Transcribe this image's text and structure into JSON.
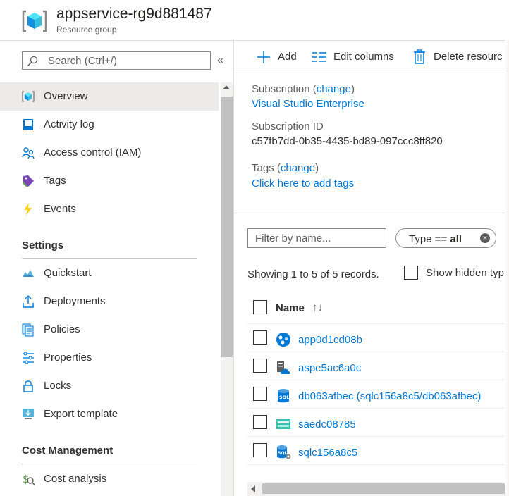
{
  "header": {
    "title": "appservice-rg9d881487",
    "subtitle": "Resource group",
    "icon": "resource-group-cube-icon"
  },
  "nav": {
    "search_placeholder": "Search (Ctrl+/)",
    "collapse_glyph": "«",
    "items": [
      {
        "label": "Overview",
        "icon": "overview-icon",
        "active": true
      },
      {
        "label": "Activity log",
        "icon": "activity-log-icon"
      },
      {
        "label": "Access control (IAM)",
        "icon": "access-control-icon"
      },
      {
        "label": "Tags",
        "icon": "tag-icon"
      },
      {
        "label": "Events",
        "icon": "events-icon"
      }
    ],
    "settings_header": "Settings",
    "settings_items": [
      {
        "label": "Quickstart",
        "icon": "quickstart-icon"
      },
      {
        "label": "Deployments",
        "icon": "deployments-icon"
      },
      {
        "label": "Policies",
        "icon": "policies-icon"
      },
      {
        "label": "Properties",
        "icon": "properties-icon"
      },
      {
        "label": "Locks",
        "icon": "lock-icon"
      },
      {
        "label": "Export template",
        "icon": "export-template-icon"
      }
    ],
    "cost_header": "Cost Management",
    "cost_items": [
      {
        "label": "Cost analysis",
        "icon": "cost-analysis-icon"
      }
    ]
  },
  "toolbar": {
    "add_label": "Add",
    "edit_columns_label": "Edit columns",
    "delete_label": "Delete resourc"
  },
  "essentials": {
    "subscription_label": "Subscription (",
    "change_link": "change",
    "close_paren": ")",
    "subscription_value": "Visual Studio Enterprise",
    "subscription_id_label": "Subscription ID",
    "subscription_id_value": "c57fb7dd-0b35-4435-bd89-097ccc8ff820",
    "tags_label": "Tags (",
    "tags_value": "Click here to add tags"
  },
  "filters": {
    "name_placeholder": "Filter by name...",
    "type_prefix": "Type == ",
    "type_value": "all",
    "clear_glyph": "×"
  },
  "list": {
    "records_text": "Showing 1 to 5 of 5 records.",
    "show_hidden_label": "Show hidden typ",
    "name_column": "Name",
    "sort_glyph": "↑↓",
    "resources": [
      {
        "name": "app0d1cd08b",
        "icon": "app-service-icon"
      },
      {
        "name": "aspe5ac6a0c",
        "icon": "app-service-plan-icon"
      },
      {
        "name": "db063afbec (sqlc156a8c5/db063afbec)",
        "icon": "sql-database-icon"
      },
      {
        "name": "saedc08785",
        "icon": "storage-account-icon"
      },
      {
        "name": "sqlc156a8c5",
        "icon": "sql-server-icon"
      }
    ]
  },
  "colors": {
    "accent": "#0078d4",
    "active_bg": "#edebe9",
    "text": "#323130"
  }
}
